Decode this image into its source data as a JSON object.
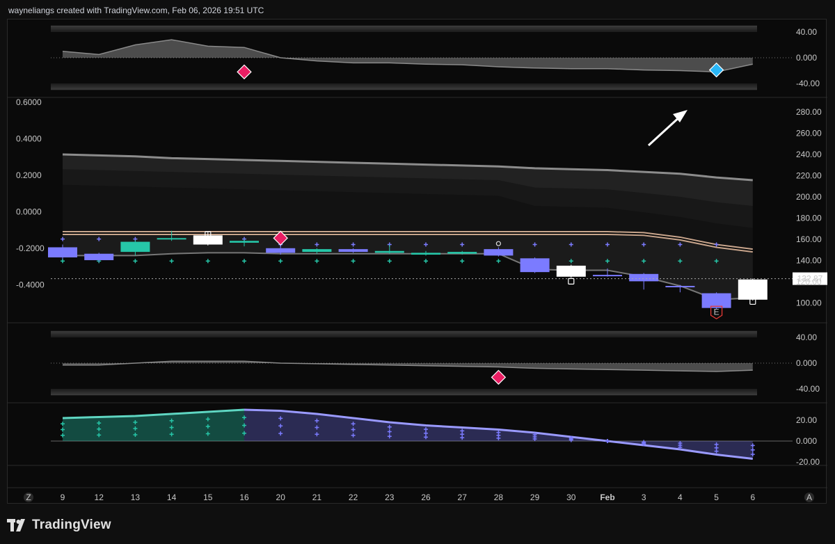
{
  "header": {
    "attribution": "wayneliangs created with TradingView.com, Feb 06, 2026 19:51 UTC"
  },
  "brand": {
    "name": "TradingView"
  },
  "colors": {
    "bull": "#26c6a8",
    "bear": "#7b7bff",
    "neutral": "#ffffff",
    "signal_red": "#e91e63",
    "signal_blue": "#29b6f6",
    "earnings": "#e53935",
    "band": "#9e9e9e",
    "ma_tan": "#c8a58c"
  },
  "chart_data": [
    {
      "type": "area",
      "name": "oscillator-top",
      "y_ticks": [
        "40.00",
        "0.000",
        "-40.00"
      ],
      "ylim": [
        -50,
        50
      ],
      "x": [
        "9",
        "12",
        "13",
        "14",
        "15",
        "16",
        "20",
        "21",
        "22",
        "23",
        "26",
        "27",
        "28",
        "29",
        "30",
        "Feb",
        "3",
        "4",
        "5",
        "6"
      ],
      "values": [
        10,
        5,
        20,
        28,
        18,
        16,
        0,
        -5,
        -8,
        -8,
        -10,
        -11,
        -14,
        -16,
        -17,
        -17,
        -19,
        -20,
        -22,
        -10
      ],
      "signals": [
        {
          "x": "16",
          "y": -22,
          "kind": "red-diamond"
        },
        {
          "x": "5",
          "y": -19,
          "kind": "blue-diamond"
        }
      ]
    },
    {
      "type": "bar",
      "name": "price-candles",
      "left_ticks": [
        "0.6000",
        "0.4000",
        "0.2000",
        "0.0000",
        "-0.2000",
        "-0.4000"
      ],
      "right_ticks": [
        "280.00",
        "260.00",
        "240.00",
        "220.00",
        "200.00",
        "180.00",
        "160.00",
        "140.00",
        "120.00",
        "100.00"
      ],
      "ylim": [
        90,
        290
      ],
      "last_price": "132.87",
      "last_value": 132.87,
      "x": [
        "9",
        "12",
        "13",
        "14",
        "15",
        "16",
        "20",
        "21",
        "22",
        "23",
        "26",
        "27",
        "28",
        "29",
        "30",
        "Feb",
        "3",
        "4",
        "5",
        "6"
      ],
      "candles": [
        {
          "o": 167,
          "c": 156,
          "h": 170,
          "l": 154,
          "color": "bear"
        },
        {
          "o": 160,
          "c": 153,
          "h": 161,
          "l": 151,
          "color": "bear"
        },
        {
          "o": 162,
          "c": 173,
          "h": 175,
          "l": 158,
          "color": "bull"
        },
        {
          "o": 176,
          "c": 177,
          "h": 185,
          "l": 174,
          "color": "bull"
        },
        {
          "o": 180,
          "c": 170,
          "h": 184,
          "l": 169,
          "color": "neutral"
        },
        {
          "o": 172,
          "c": 174,
          "h": 176,
          "l": 168,
          "color": "bull"
        },
        {
          "o": 166,
          "c": 161,
          "h": 168,
          "l": 159,
          "color": "bear"
        },
        {
          "o": 162,
          "c": 165,
          "h": 166,
          "l": 160,
          "color": "bull"
        },
        {
          "o": 165,
          "c": 162,
          "h": 166,
          "l": 161,
          "color": "bear"
        },
        {
          "o": 161,
          "c": 163,
          "h": 170,
          "l": 160,
          "color": "bull"
        },
        {
          "o": 159,
          "c": 161,
          "h": 163,
          "l": 158,
          "color": "bull"
        },
        {
          "o": 160,
          "c": 162,
          "h": 163,
          "l": 159,
          "color": "bull"
        },
        {
          "o": 165,
          "c": 158,
          "h": 167,
          "l": 157,
          "color": "bear"
        },
        {
          "o": 155,
          "c": 140,
          "h": 156,
          "l": 139,
          "color": "bear"
        },
        {
          "o": 147,
          "c": 135,
          "h": 148,
          "l": 134,
          "color": "neutral"
        },
        {
          "o": 137,
          "c": 136,
          "h": 144,
          "l": 135,
          "color": "bear"
        },
        {
          "o": 138,
          "c": 130,
          "h": 139,
          "l": 121,
          "color": "bear"
        },
        {
          "o": 125,
          "c": 124,
          "h": 126,
          "l": 118,
          "color": "bear"
        },
        {
          "o": 117,
          "c": 101,
          "h": 118,
          "l": 100,
          "color": "bear"
        },
        {
          "o": 110,
          "c": 132,
          "h": 133,
          "l": 109,
          "color": "neutral"
        }
      ],
      "band_upper": [
        268,
        267,
        266,
        264,
        263,
        262,
        261,
        260,
        259,
        258,
        257,
        256,
        255,
        253,
        252,
        251,
        249,
        247,
        243,
        240
      ],
      "band_inner1": [
        252,
        251,
        250,
        249,
        248,
        247,
        246,
        245,
        244,
        243,
        242,
        241,
        240,
        232,
        231,
        230,
        226,
        222,
        216,
        212
      ],
      "band_inner2": [
        235,
        234,
        233,
        232,
        231,
        230,
        229,
        228,
        227,
        226,
        225,
        224,
        223,
        212,
        211,
        210,
        205,
        200,
        193,
        188
      ],
      "ma_upper": [
        184,
        184,
        184,
        184,
        184,
        184,
        184,
        184,
        184,
        184,
        184,
        184,
        184,
        184,
        184,
        184,
        183,
        178,
        170,
        165
      ],
      "ma_lower": [
        181,
        181,
        181,
        181,
        181,
        181,
        181,
        181,
        181,
        181,
        181,
        181,
        181,
        181,
        181,
        181,
        180,
        175,
        167,
        162
      ],
      "band_lower": [
        158,
        158,
        158,
        160,
        161,
        161,
        160,
        160,
        160,
        160,
        160,
        160,
        160,
        143,
        142,
        142,
        135,
        125,
        110,
        112
      ],
      "plus_top": [
        176,
        176,
        176,
        null,
        176,
        176,
        170,
        170,
        170,
        170,
        170,
        170,
        null,
        170,
        170,
        170,
        170,
        170,
        170,
        null
      ],
      "plus_bottom": [
        152,
        152,
        152,
        152,
        152,
        152,
        152,
        152,
        152,
        152,
        152,
        152,
        152,
        152,
        152,
        152,
        152,
        152,
        152,
        null
      ],
      "markers": [
        {
          "x": "20",
          "y": 177,
          "kind": "red-diamond"
        },
        {
          "x": "15",
          "y": 181,
          "kind": "square"
        },
        {
          "x": "30",
          "y": 130,
          "kind": "square"
        },
        {
          "x": "6",
          "y": 108,
          "kind": "square"
        },
        {
          "x": "28",
          "y": 171,
          "kind": "pin"
        },
        {
          "x": "5",
          "y": 96,
          "kind": "earnings"
        }
      ],
      "earnings_label": "E"
    },
    {
      "type": "area",
      "name": "oscillator-middle",
      "y_ticks": [
        "40.00",
        "0.000",
        "-40.00"
      ],
      "ylim": [
        -50,
        50
      ],
      "x": [
        "9",
        "12",
        "13",
        "14",
        "15",
        "16",
        "20",
        "21",
        "22",
        "23",
        "26",
        "27",
        "28",
        "29",
        "30",
        "Feb",
        "3",
        "4",
        "5",
        "6"
      ],
      "values": [
        -3,
        -3,
        0,
        3,
        3,
        3,
        0,
        -1,
        -2,
        -3,
        -4,
        -5,
        -6,
        -8,
        -9,
        -10,
        -11,
        -12,
        -13,
        -11
      ],
      "signals": [
        {
          "x": "28",
          "y": -22,
          "kind": "red-diamond"
        }
      ]
    },
    {
      "type": "area",
      "name": "momentum-histogram",
      "y_ticks": [
        "20.00",
        "0.000",
        "-20.00"
      ],
      "ylim": [
        -25,
        30
      ],
      "x": [
        "9",
        "12",
        "13",
        "14",
        "15",
        "16",
        "20",
        "21",
        "22",
        "23",
        "26",
        "27",
        "28",
        "29",
        "30",
        "Feb",
        "3",
        "4",
        "5",
        "6"
      ],
      "values": [
        22,
        23,
        24,
        26,
        28,
        30,
        29,
        26,
        22,
        18,
        15,
        13,
        11,
        8,
        4,
        0,
        -4,
        -8,
        -13,
        -17
      ]
    }
  ],
  "x_axis": {
    "labels": [
      "9",
      "12",
      "13",
      "14",
      "15",
      "16",
      "20",
      "21",
      "22",
      "23",
      "26",
      "27",
      "28",
      "29",
      "30",
      "Feb",
      "3",
      "4",
      "5",
      "6"
    ],
    "left_button": "Z",
    "right_button": "A"
  }
}
